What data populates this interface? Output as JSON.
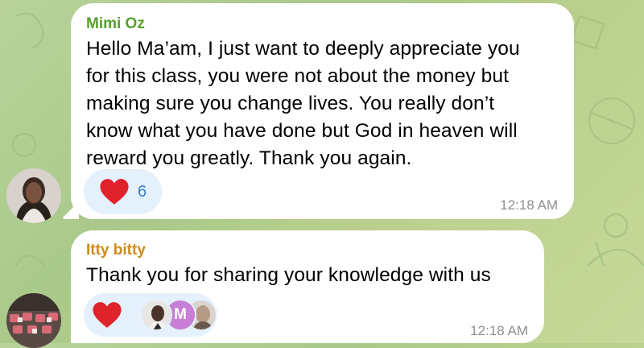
{
  "theme": {
    "sender1_color": "#57a02d",
    "sender2_color": "#d08a1c",
    "reaction_bg": "#e4f0fb",
    "count_color": "#3a7ec4",
    "heart_color": "#e0222b",
    "time_color": "#8d8f93"
  },
  "messages": [
    {
      "sender": "Mimi Oz",
      "text": "Hello Ma’am, I just want to deeply appreciate you\nfor this class, you were not about the money but\nmaking sure you change lives. You really don’t\nknow what you have done but God in heaven will\nreward you greatly. Thank you again.",
      "reaction": {
        "icon": "heart-icon",
        "count": "6"
      },
      "time": "12:18 AM"
    },
    {
      "sender": "Itty bitty",
      "text": "Thank you for sharing your knowledge with us",
      "reaction": {
        "icon": "heart-icon",
        "reactor_initial": "M"
      },
      "time": "12:18 AM"
    }
  ]
}
